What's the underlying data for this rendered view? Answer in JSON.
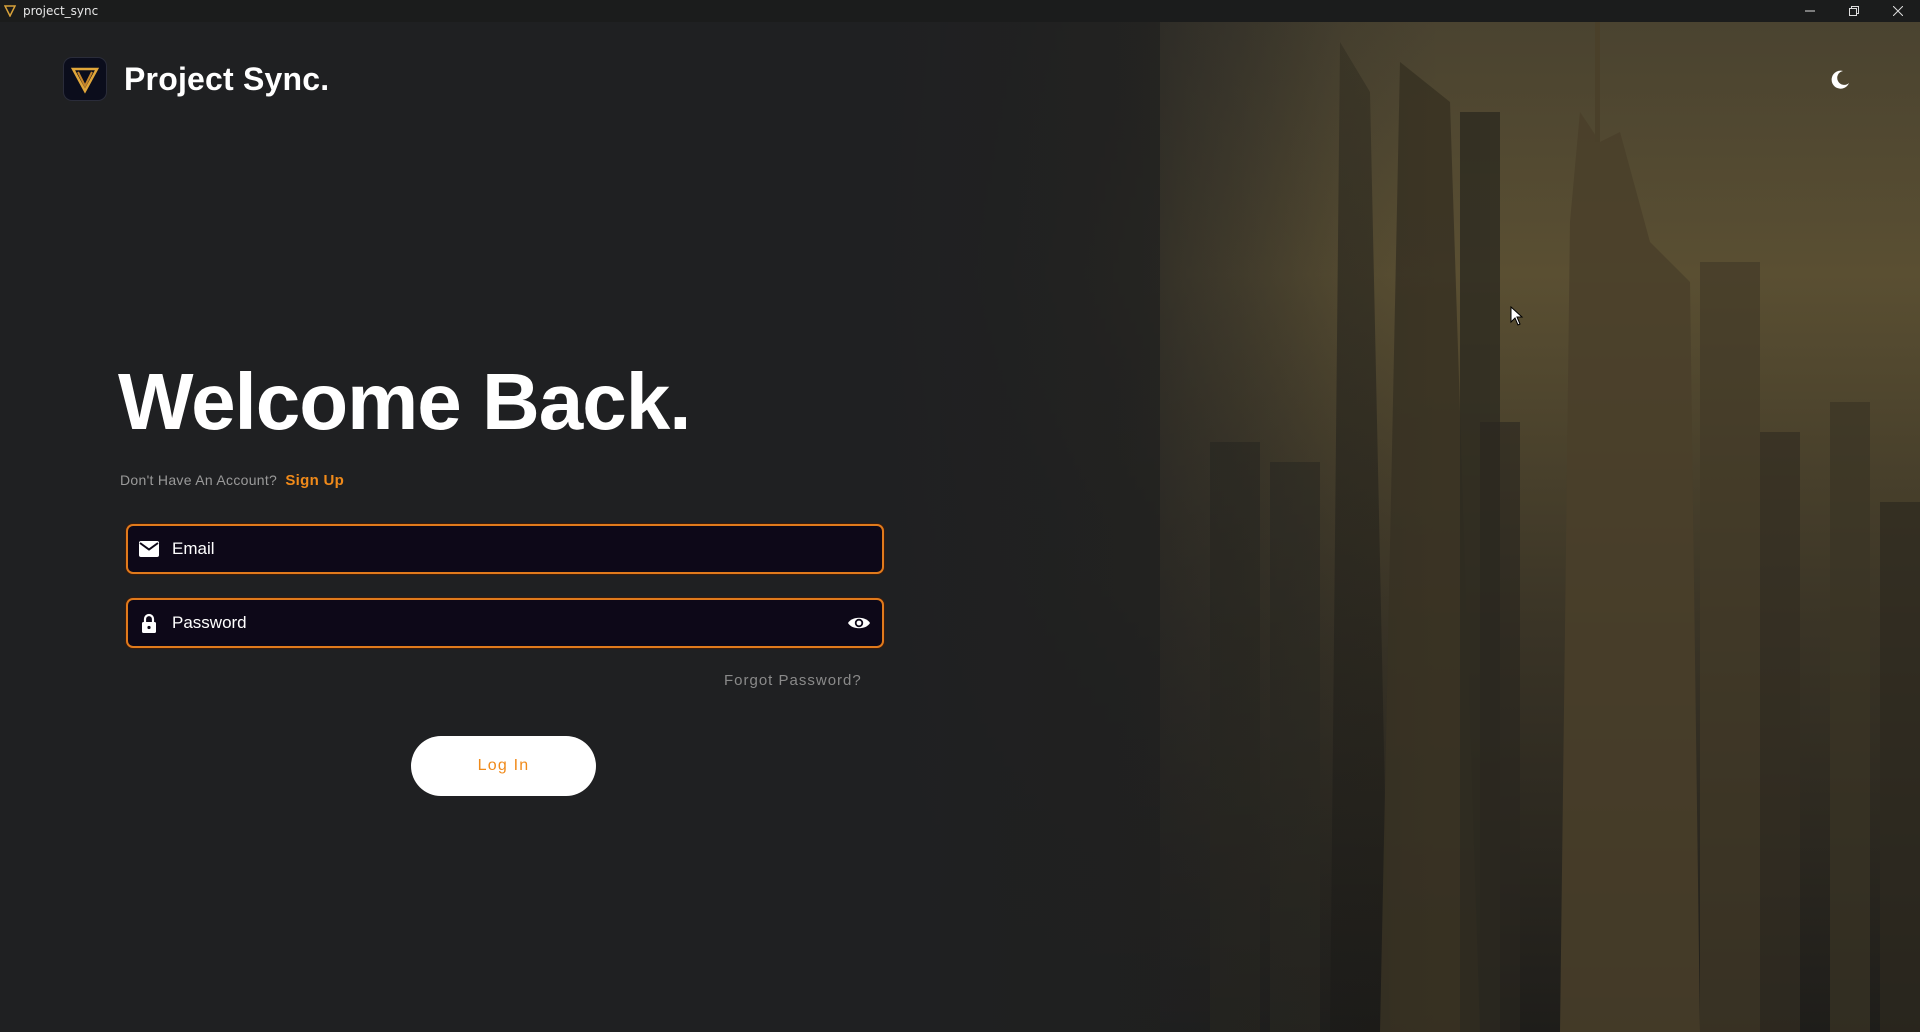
{
  "window": {
    "title": "project_sync",
    "controls": [
      "minimize-icon",
      "restore-icon",
      "close-icon"
    ]
  },
  "brand": {
    "name": "Project Sync.",
    "logo_icon": "v-triangle-logo"
  },
  "theme_toggle": {
    "icon": "moon-icon"
  },
  "login": {
    "heading": "Welcome Back.",
    "signup_prompt": "Don't Have An Account?",
    "signup_link": "Sign Up",
    "email": {
      "placeholder": "Email",
      "value": "",
      "icon": "mail-icon"
    },
    "password": {
      "placeholder": "Password",
      "value": "",
      "icon": "lock-icon",
      "toggle_icon": "eye-icon"
    },
    "forgot_password": "Forgot Password?",
    "submit_label": "Log In"
  },
  "colors": {
    "accent": "#f08a1a",
    "field_border": "#e07a1c",
    "field_bg": "#0d0818",
    "page_bg": "#1f2022"
  }
}
